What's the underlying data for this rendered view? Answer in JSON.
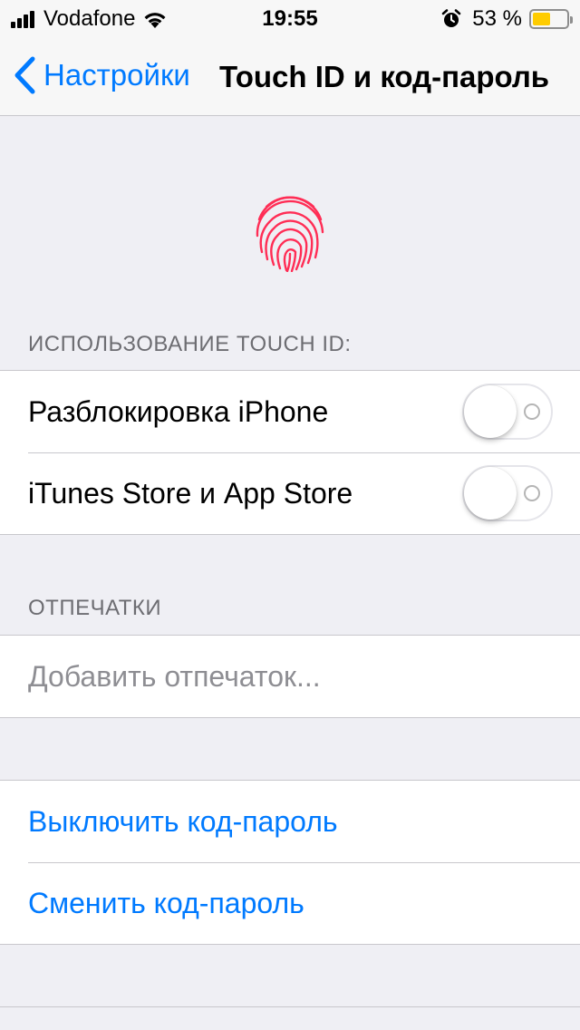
{
  "status_bar": {
    "carrier": "Vodafone",
    "time": "19:55",
    "battery_percent": "53 %",
    "battery_level": 0.53,
    "icons": [
      "signal-bars-icon",
      "wifi-icon",
      "alarm-icon",
      "battery-icon"
    ],
    "battery_color": "#ffcc00"
  },
  "nav": {
    "back_label": "Настройки",
    "title": "Touch ID и код-пароль"
  },
  "touch_id_section": {
    "header": "ИСПОЛЬЗОВАНИЕ TOUCH ID:",
    "rows": [
      {
        "label": "Разблокировка iPhone",
        "enabled": false
      },
      {
        "label": "iTunes Store и App Store",
        "enabled": false
      }
    ]
  },
  "fingerprints_section": {
    "header": "ОТПЕЧАТКИ",
    "add_label": "Добавить отпечаток..."
  },
  "passcode_section": {
    "turn_off_label": "Выключить код-пароль",
    "change_label": "Сменить код-пароль"
  },
  "colors": {
    "accent": "#007aff",
    "fingerprint": "#ff2d55",
    "background": "#efeff4"
  }
}
